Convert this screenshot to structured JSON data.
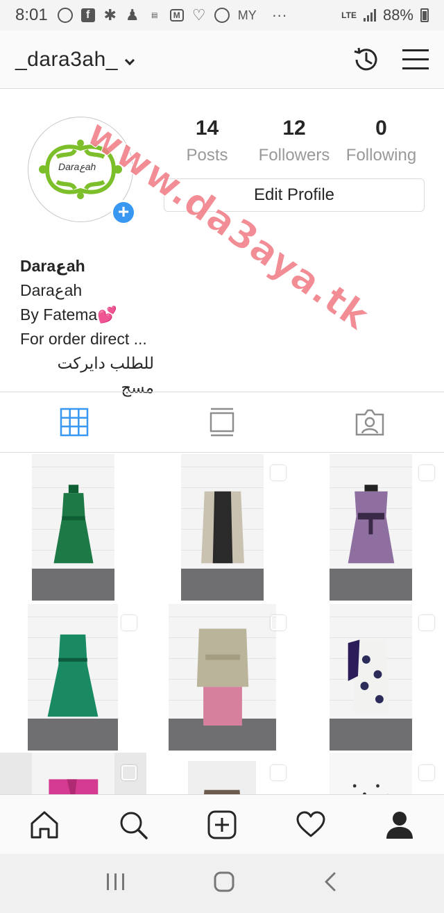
{
  "status_bar": {
    "time": "8:01",
    "carrier_label": "MY",
    "more": "···",
    "network": "LTE",
    "battery": "88%",
    "icons": [
      "whatsapp-icon",
      "facebook-icon",
      "settings-badge-icon",
      "accessibility-icon",
      "app-icon",
      "gmail-icon",
      "app-icon",
      "sync-icon"
    ]
  },
  "header": {
    "username": "_dara3ah_",
    "icons": [
      "history-icon",
      "menu-icon"
    ]
  },
  "profile": {
    "avatar_text": "Daraعah",
    "stats": [
      {
        "value": "14",
        "label": "Posts"
      },
      {
        "value": "12",
        "label": "Followers"
      },
      {
        "value": "0",
        "label": "Following"
      }
    ],
    "edit_button": "Edit Profile",
    "bio": {
      "name": "Daraعah",
      "line1": "Daraعah",
      "line2": "By Fatema💕",
      "line3": "For order direct ...",
      "line4": "للطلب دايركت مسج"
    }
  },
  "tabs": [
    "grid-icon",
    "feed-icon",
    "tagged-icon"
  ],
  "grid": [
    {
      "dress_color": "#1d7a46",
      "badge": "video"
    },
    {
      "dress_color": "#2a2a2a",
      "badge": "multi"
    },
    {
      "dress_color": "#8e6fa0",
      "badge": "multi"
    },
    {
      "dress_color": "#1a8a63",
      "badge": "multi"
    },
    {
      "dress_color": "#b9b49a",
      "badge": "multi"
    },
    {
      "dress_color": "#f2f2f0",
      "badge": "multi"
    },
    {
      "dress_color": "#d43a8f",
      "badge": "multi"
    },
    {
      "dress_color": "#6b5a4e",
      "badge": "multi"
    },
    {
      "dress_color": "#f7f7f7",
      "badge": "multi"
    }
  ],
  "bottom_nav": [
    "home-icon",
    "search-icon",
    "add-post-icon",
    "heart-icon",
    "profile-icon"
  ],
  "system_nav": [
    "recent-apps-icon",
    "home-button-icon",
    "back-icon"
  ],
  "watermark": "www.da3aya.tk",
  "colors": {
    "accent": "#3897f0",
    "watermark": "#f07882"
  }
}
